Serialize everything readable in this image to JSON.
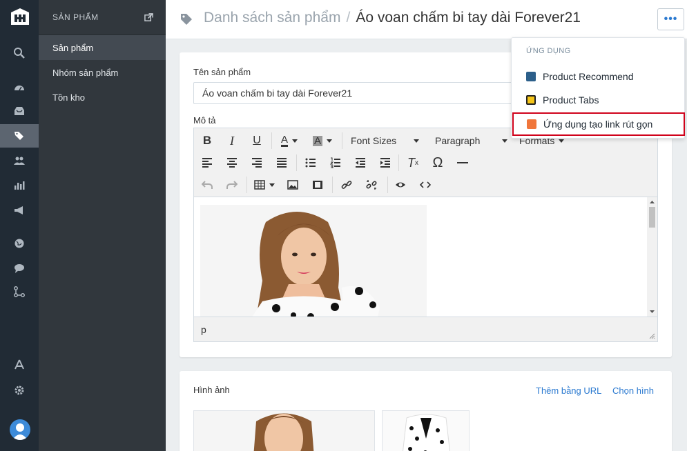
{
  "rail": {
    "items": [
      "logo",
      "search-icon",
      "dashboard-icon",
      "inbox-icon",
      "tags-icon",
      "users-icon",
      "chart-icon",
      "megaphone-icon",
      "globe-icon",
      "chat-icon",
      "share-icon",
      "app-store-icon",
      "gear-icon",
      "avatar"
    ],
    "active": "tags-icon"
  },
  "sidebar": {
    "title": "SẢN PHẨM",
    "items": [
      {
        "label": "Sản phẩm",
        "active": true
      },
      {
        "label": "Nhóm sản phẩm",
        "active": false
      },
      {
        "label": "Tồn kho",
        "active": false
      }
    ]
  },
  "header": {
    "breadcrumb_parent": "Danh sách sản phẩm",
    "separator": "/",
    "breadcrumb_current": "Áo voan chấm bi tay dài Forever21",
    "more_label": "•••"
  },
  "form": {
    "name_label": "Tên sản phẩm",
    "name_value": "Áo voan chấm bi tay dài Forever21",
    "desc_label": "Mô tả"
  },
  "editor": {
    "font_sizes": "Font Sizes",
    "paragraph": "Paragraph",
    "formats": "Formats",
    "status_path": "p"
  },
  "images": {
    "title": "Hình ảnh",
    "add_url": "Thêm bằng URL",
    "choose": "Chọn hình"
  },
  "dropdown": {
    "heading": "ỨNG DỤNG",
    "items": [
      {
        "label": "Product Recommend",
        "icon": "recommend-icon",
        "color": "#2c5f8a"
      },
      {
        "label": "Product Tabs",
        "icon": "tabs-icon",
        "color": "#f5c518"
      },
      {
        "label": "Ứng dụng tạo link rút gọn",
        "icon": "link-icon",
        "color": "#f0763b",
        "highlighted": true
      }
    ]
  },
  "colors": {
    "rail_bg": "#212b35",
    "sidebar_bg": "#31373d",
    "accent": "#2a79d0",
    "highlight_border": "#d0021b"
  }
}
